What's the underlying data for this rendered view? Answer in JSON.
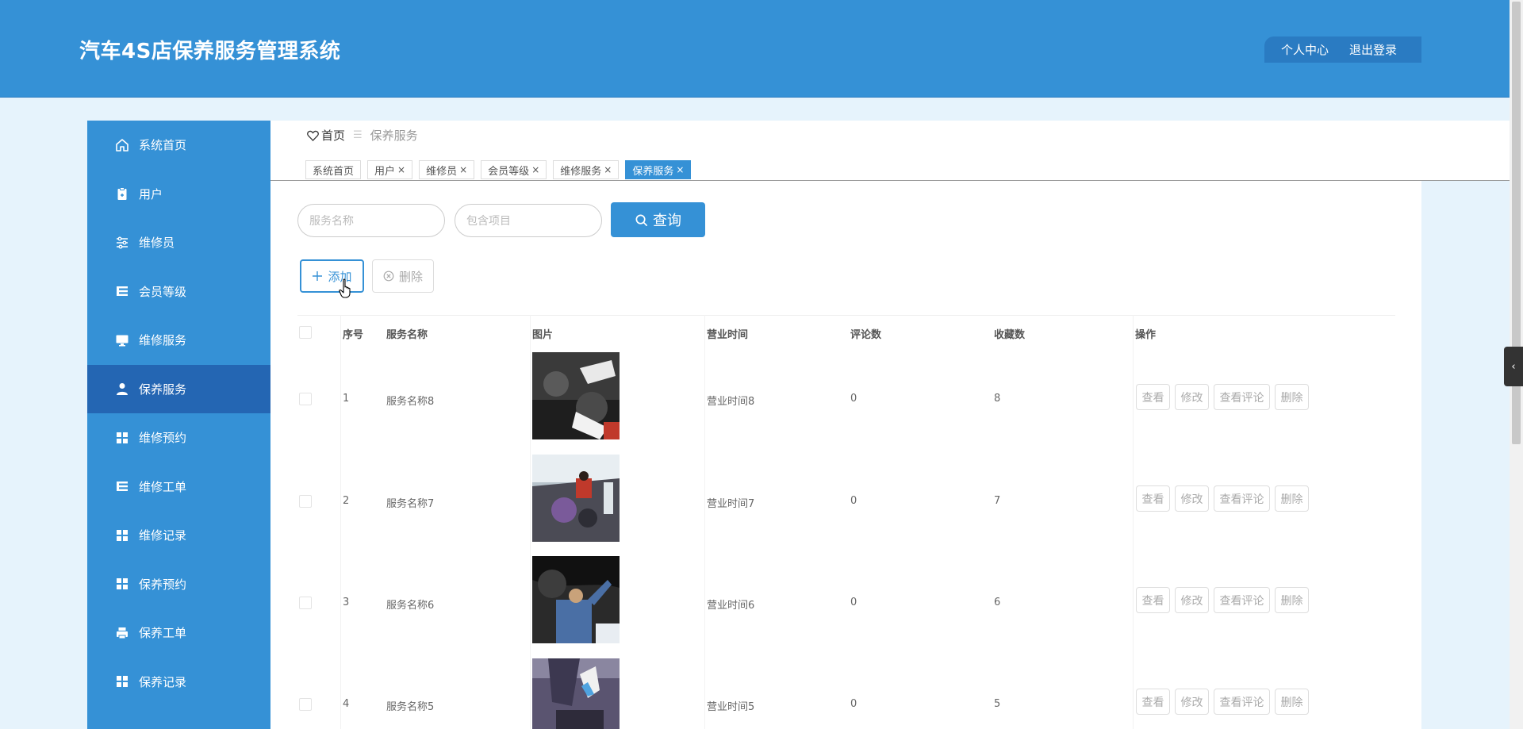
{
  "header": {
    "title": "汽车4S店保养服务管理系统",
    "profile_label": "个人中心",
    "logout_label": "退出登录"
  },
  "sidebar": {
    "items": [
      {
        "label": "系统首页",
        "icon": "home-icon"
      },
      {
        "label": "用户",
        "icon": "clipboard-icon"
      },
      {
        "label": "维修员",
        "icon": "sliders-icon"
      },
      {
        "label": "会员等级",
        "icon": "list-icon"
      },
      {
        "label": "维修服务",
        "icon": "monitor-icon"
      },
      {
        "label": "保养服务",
        "icon": "user-icon",
        "active": true
      },
      {
        "label": "维修预约",
        "icon": "grid-icon"
      },
      {
        "label": "维修工单",
        "icon": "list-icon"
      },
      {
        "label": "维修记录",
        "icon": "grid-icon"
      },
      {
        "label": "保养预约",
        "icon": "grid-icon"
      },
      {
        "label": "保养工单",
        "icon": "printer-icon"
      },
      {
        "label": "保养记录",
        "icon": "grid-icon"
      }
    ]
  },
  "breadcrumb": {
    "home": "首页",
    "separator": "☰",
    "current": "保养服务"
  },
  "tabs": [
    {
      "label": "系统首页",
      "closable": false
    },
    {
      "label": "用户",
      "closable": true
    },
    {
      "label": "维修员",
      "closable": true
    },
    {
      "label": "会员等级",
      "closable": true
    },
    {
      "label": "维修服务",
      "closable": true
    },
    {
      "label": "保养服务",
      "closable": true,
      "active": true
    }
  ],
  "tab_close_glyph": "×",
  "search": {
    "service_name_placeholder": "服务名称",
    "items_placeholder": "包含项目",
    "button_label": "查询"
  },
  "actions": {
    "add_label": "添加",
    "delete_label": "删除"
  },
  "table": {
    "columns": [
      "序号",
      "服务名称",
      "图片",
      "营业时间",
      "评论数",
      "收藏数",
      "操作"
    ],
    "rows": [
      {
        "index": "1",
        "name": "服务名称8",
        "hours": "营业时间8",
        "comments": "0",
        "favorites": "8"
      },
      {
        "index": "2",
        "name": "服务名称7",
        "hours": "营业时间7",
        "comments": "0",
        "favorites": "7"
      },
      {
        "index": "3",
        "name": "服务名称6",
        "hours": "营业时间6",
        "comments": "0",
        "favorites": "6"
      },
      {
        "index": "4",
        "name": "服务名称5",
        "hours": "营业时间5",
        "comments": "0",
        "favorites": "5"
      }
    ],
    "row_actions": [
      "查看",
      "修改",
      "查看评论",
      "删除"
    ]
  },
  "side_toggle_glyph": "‹",
  "colors": {
    "primary": "#3591d6",
    "sidebar_active": "#2466b3",
    "page_bg": "#e6f3fc"
  }
}
